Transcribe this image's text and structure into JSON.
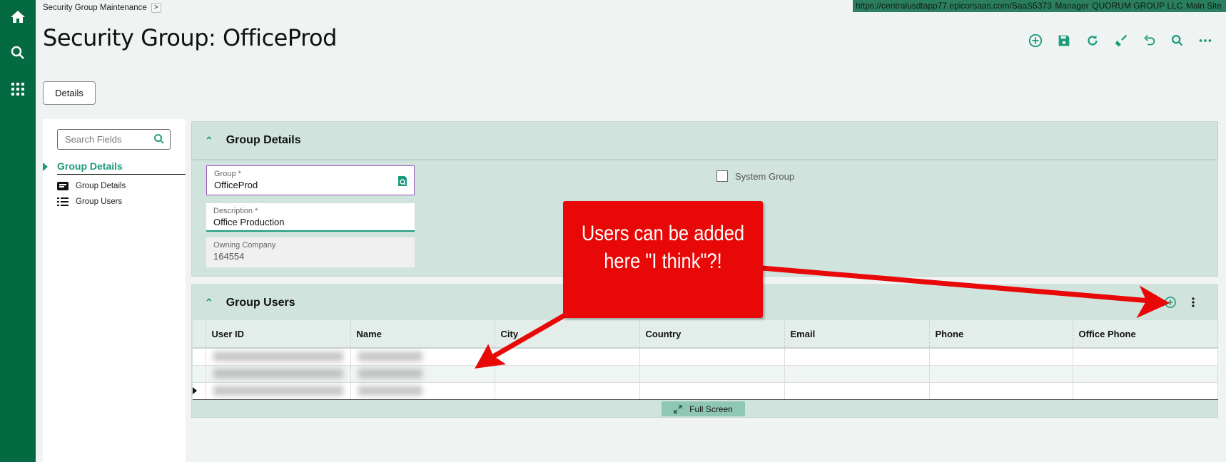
{
  "topbar": {
    "url": "https://centralusdtapp77.epicorsaas.com/SaaS5373",
    "role": "Manager",
    "company": "QUORUM GROUP LLC",
    "site": "Main Site"
  },
  "breadcrumb": {
    "label": "Security Group Maintenance",
    "chevron": ">"
  },
  "page_title": "Security Group: OfficeProd",
  "nav_icons": [
    "home-icon",
    "search-icon",
    "apps-grid-icon"
  ],
  "toolbar": [
    "add-icon",
    "save-icon",
    "refresh-icon",
    "clear-icon",
    "undo-icon",
    "search-icon",
    "more-icon"
  ],
  "details_button": "Details",
  "left_nav": {
    "search_placeholder": "Search Fields",
    "section": "Group Details",
    "items": [
      {
        "label": "Group Details",
        "icon": "card-icon"
      },
      {
        "label": "Group Users",
        "icon": "list-icon"
      }
    ]
  },
  "group_details": {
    "title": "Group Details",
    "group_label": "Group *",
    "group_value": "OfficeProd",
    "description_label": "Description *",
    "description_value": "Office Production",
    "owning_label": "Owning Company",
    "owning_value": "164554",
    "system_group_label": "System Group",
    "system_group_checked": false
  },
  "group_users": {
    "title": "Group Users",
    "columns": [
      "User ID",
      "Name",
      "City",
      "Country",
      "Email",
      "Phone",
      "Office Phone"
    ],
    "row_count": 3,
    "full_screen": "Full Screen"
  },
  "annotation": {
    "text": "Users can be added here \"I think\"?!",
    "color": "#e80808"
  },
  "colors": {
    "accent": "#1a9a7b",
    "nav": "#046a42",
    "panel": "#d0e3dd"
  }
}
